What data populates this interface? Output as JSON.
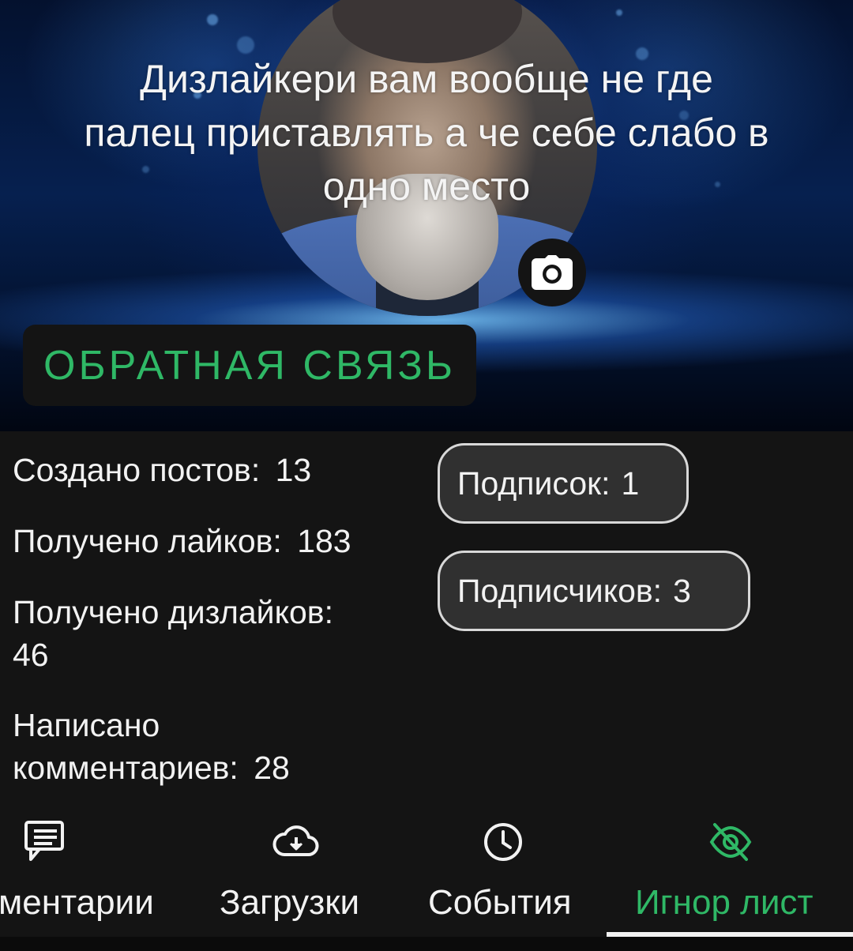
{
  "header": {
    "status_text": "Дизлайкери вам вообще не где палец приставлять а че себе слабо в одно место",
    "feedback_label": "ОБРАТНАЯ СВЯЗЬ"
  },
  "stats": {
    "posts_label": "Создано постов:",
    "posts_value": "13",
    "likes_label": "Получено лайков:",
    "likes_value": "183",
    "dislikes_label": "Получено дизлайков:",
    "dislikes_value": "46",
    "comments_label_line1": "Написано",
    "comments_label_line2": "комментариев:",
    "comments_value": "28"
  },
  "follow": {
    "subscriptions_label": "Подписок:",
    "subscriptions_value": "1",
    "followers_label": "Подписчиков:",
    "followers_value": "3"
  },
  "tabs": [
    {
      "label": "ментарии",
      "icon": "comments-icon",
      "active": false
    },
    {
      "label": "Загрузки",
      "icon": "cloud-download-icon",
      "active": false
    },
    {
      "label": "События",
      "icon": "clock-icon",
      "active": false
    },
    {
      "label": "Игнор лист",
      "icon": "eye-off-icon",
      "active": true
    }
  ],
  "colors": {
    "accent": "#2fb866",
    "background": "#141414",
    "pill_bg": "#303030"
  }
}
